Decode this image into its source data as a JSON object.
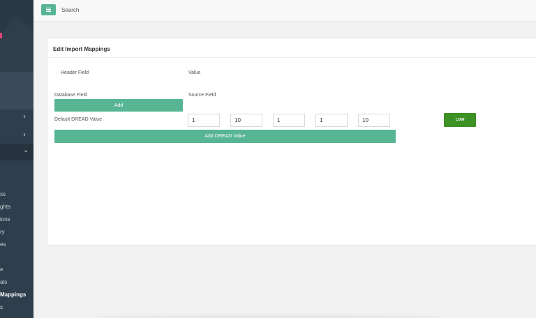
{
  "header": {
    "search_label": "Search",
    "menu_icon": "hamburger-icon"
  },
  "sidebar": {
    "items": [
      {
        "label": "xs"
      },
      {
        "label": "ghts"
      },
      {
        "label": "ions"
      },
      {
        "label": "ry"
      },
      {
        "label": "es"
      },
      {
        "label": "e"
      },
      {
        "label": "als"
      },
      {
        "label": "Mappings"
      },
      {
        "label": "s"
      }
    ],
    "chevrons": [
      "‹",
      "‹",
      "⌄"
    ]
  },
  "panel": {
    "title": "Edit Import Mappings",
    "header_field_label": "Header Field",
    "value_label": "Value",
    "database_field_label": "Database Field",
    "source_field_label": "Source Field",
    "add_button": "Add",
    "default_dread_label": "Default DREAD Value",
    "dread_values": [
      "1",
      "10",
      "1",
      "1",
      "10"
    ],
    "risk_level": "LOW",
    "add_dread_button": "Add DREAD Value"
  },
  "colors": {
    "accent": "#57b594",
    "sidebar": "#2f3e4c",
    "risk_low": "#3e9125"
  }
}
